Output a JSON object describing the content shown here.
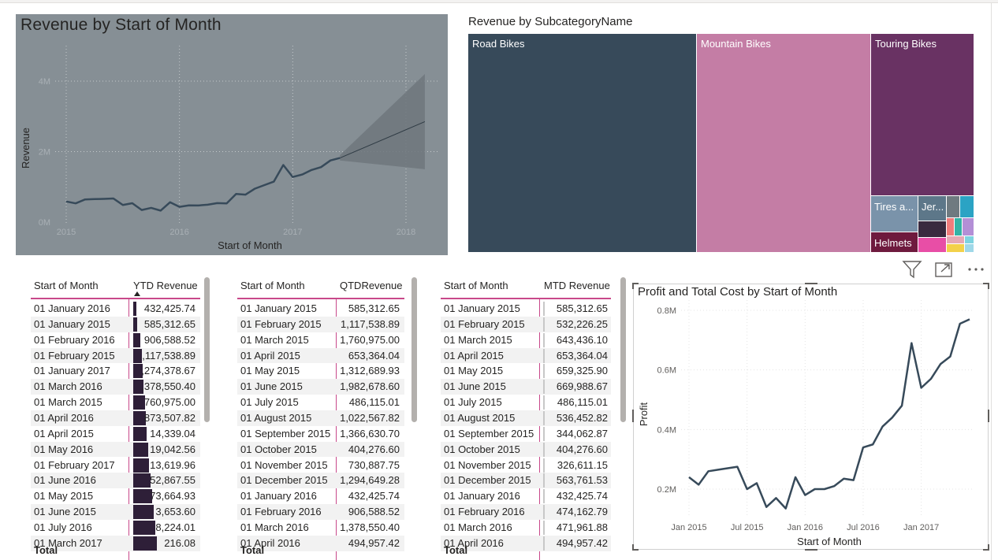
{
  "colors": {
    "accent": "#c8488a",
    "dark_bar": "#2e1f38",
    "line_dark": "#374a5a"
  },
  "revenue_chart": {
    "title": "Revenue by Start of Month",
    "xlabel": "Start of Month",
    "ylabel": "Revenue",
    "yticks": [
      "4M",
      "2M",
      "0M"
    ],
    "xticks": [
      "2015",
      "2016",
      "2017",
      "2018"
    ]
  },
  "treemap": {
    "title": "Revenue by SubcategoryName",
    "items": [
      {
        "name": "Road Bikes",
        "label": "Road Bikes",
        "color": "#374a5a"
      },
      {
        "name": "Mountain Bikes",
        "label": "Mountain Bikes",
        "color": "#c47da5"
      },
      {
        "name": "Touring Bikes",
        "label": "Touring Bikes",
        "color": "#693263"
      },
      {
        "name": "Tires and Tubes",
        "label": "Tires a...",
        "color": "#7a93aa"
      },
      {
        "name": "Jerseys",
        "label": "Jer...",
        "color": "#5d7789"
      },
      {
        "name": "Helmets",
        "label": "Helmets",
        "color": "#6e1a3e"
      }
    ]
  },
  "ytd_table": {
    "headers": [
      "Start of Month",
      "YTD Revenue"
    ],
    "rows": [
      [
        "01 January 2016",
        "432,425.74"
      ],
      [
        "01 January 2015",
        "585,312.65"
      ],
      [
        "01 February 2016",
        "906,588.52"
      ],
      [
        "01 February 2015",
        ",117,538.89"
      ],
      [
        "01 January 2017",
        ",274,378.67"
      ],
      [
        "01 March 2016",
        ",378,550.40"
      ],
      [
        "01 March 2015",
        "760,975.00"
      ],
      [
        "01 April 2016",
        "873,507.82"
      ],
      [
        "01 April 2015",
        "14,339.04"
      ],
      [
        "01 May 2016",
        "19,042.56"
      ],
      [
        "01 February 2017",
        "13,619.96"
      ],
      [
        "01 June 2016",
        "52,867.55"
      ],
      [
        "01 May 2015",
        "73,664.93"
      ],
      [
        "01 June 2015",
        "3,653.60"
      ],
      [
        "01 July 2016",
        "8,224.01"
      ],
      [
        "01 March 2017",
        "216.08"
      ]
    ],
    "total_label": "Total"
  },
  "qtd_table": {
    "headers": [
      "Start of Month",
      "QTDRevenue"
    ],
    "rows": [
      [
        "01 January 2015",
        "585,312.65"
      ],
      [
        "01 February 2015",
        "1,117,538.89"
      ],
      [
        "01 March 2015",
        "1,760,975.00"
      ],
      [
        "01 April 2015",
        "653,364.04"
      ],
      [
        "01 May 2015",
        "1,312,689.93"
      ],
      [
        "01 June 2015",
        "1,982,678.60"
      ],
      [
        "01 July 2015",
        "486,115.01"
      ],
      [
        "01 August 2015",
        "1,022,567.82"
      ],
      [
        "01 September 2015",
        "1,366,630.70"
      ],
      [
        "01 October 2015",
        "404,276.60"
      ],
      [
        "01 November 2015",
        "730,887.75"
      ],
      [
        "01 December 2015",
        "1,294,649.28"
      ],
      [
        "01 January 2016",
        "432,425.74"
      ],
      [
        "01 February 2016",
        "906,588.52"
      ],
      [
        "01 March 2016",
        "1,378,550.40"
      ],
      [
        "01 April 2016",
        "494,957.42"
      ]
    ],
    "total_label": "Total"
  },
  "mtd_table": {
    "headers": [
      "Start of Month",
      "MTD Revenue"
    ],
    "rows": [
      [
        "01 January 2015",
        "585,312.65"
      ],
      [
        "01 February 2015",
        "532,226.25"
      ],
      [
        "01 March 2015",
        "643,436.10"
      ],
      [
        "01 April 2015",
        "653,364.04"
      ],
      [
        "01 May 2015",
        "659,325.90"
      ],
      [
        "01 June 2015",
        "669,988.67"
      ],
      [
        "01 July 2015",
        "486,115.01"
      ],
      [
        "01 August 2015",
        "536,452.82"
      ],
      [
        "01 September 2015",
        "344,062.87"
      ],
      [
        "01 October 2015",
        "404,276.60"
      ],
      [
        "01 November 2015",
        "326,611.15"
      ],
      [
        "01 December 2015",
        "563,761.53"
      ],
      [
        "01 January 2016",
        "432,425.74"
      ],
      [
        "01 February 2016",
        "474,162.79"
      ],
      [
        "01 March 2016",
        "471,961.88"
      ],
      [
        "01 April 2016",
        "494,957.42"
      ]
    ],
    "total_label": "Total"
  },
  "profit_chart": {
    "title": "Profit and Total Cost by Start of Month",
    "xlabel": "Start of Month",
    "ylabel": "Profit",
    "yticks": [
      "0.8M",
      "0.6M",
      "0.4M",
      "0.2M"
    ],
    "xticks": [
      "Jan 2015",
      "Jul 2015",
      "Jan 2016",
      "Jul 2016",
      "Jan 2017"
    ]
  },
  "toolbar": {
    "icons": [
      "filter-icon",
      "focus-mode-icon",
      "more-options-icon"
    ]
  },
  "chart_data": [
    {
      "type": "line",
      "title": "Revenue by Start of Month",
      "xlabel": "Start of Month",
      "ylabel": "Revenue",
      "ylim": [
        0,
        4500000
      ],
      "x": [
        "2015-01",
        "2015-02",
        "2015-03",
        "2015-04",
        "2015-05",
        "2015-06",
        "2015-07",
        "2015-08",
        "2015-09",
        "2015-10",
        "2015-11",
        "2015-12",
        "2016-01",
        "2016-02",
        "2016-03",
        "2016-04",
        "2016-05",
        "2016-06",
        "2016-07",
        "2016-08",
        "2016-09",
        "2016-10",
        "2016-11",
        "2016-12",
        "2017-01",
        "2017-02",
        "2017-03",
        "2017-04",
        "2017-05",
        "2017-06"
      ],
      "series": [
        {
          "values": [
            585312,
            532226,
            643436,
            653364,
            659326,
            669989,
            486115,
            536453,
            344063,
            404277,
            326611,
            563762,
            432426,
            474163,
            471962,
            494957,
            540000,
            530000,
            800000,
            780000,
            950000,
            1050000,
            1150000,
            1620000,
            1280000,
            1350000,
            1480000,
            1560000,
            1750000,
            1820000
          ]
        }
      ],
      "forecast": {
        "x": [
          "2017-06",
          "2018-03"
        ],
        "values": [
          1820000,
          2850000
        ],
        "upper": [
          1900000,
          4200000
        ],
        "lower": [
          1750000,
          1500000
        ]
      },
      "grid": true
    },
    {
      "type": "line",
      "title": "Profit and Total Cost by Start of Month",
      "xlabel": "Start of Month",
      "ylabel": "Profit",
      "ylim": [
        0.1,
        0.85
      ],
      "x": [
        "2015-01",
        "2015-02",
        "2015-03",
        "2015-04",
        "2015-05",
        "2015-06",
        "2015-07",
        "2015-08",
        "2015-09",
        "2015-10",
        "2015-11",
        "2015-12",
        "2016-01",
        "2016-02",
        "2016-03",
        "2016-04",
        "2016-05",
        "2016-06",
        "2016-07",
        "2016-08",
        "2016-09",
        "2016-10",
        "2016-11",
        "2016-12",
        "2017-01",
        "2017-02",
        "2017-03",
        "2017-04",
        "2017-05",
        "2017-06"
      ],
      "series": [
        {
          "values": [
            0.24,
            0.215,
            0.26,
            0.265,
            0.27,
            0.275,
            0.2,
            0.22,
            0.14,
            0.17,
            0.135,
            0.24,
            0.18,
            0.2,
            0.2,
            0.21,
            0.235,
            0.23,
            0.34,
            0.35,
            0.41,
            0.44,
            0.48,
            0.69,
            0.54,
            0.57,
            0.62,
            0.645,
            0.755,
            0.77
          ]
        }
      ],
      "grid": true
    }
  ]
}
